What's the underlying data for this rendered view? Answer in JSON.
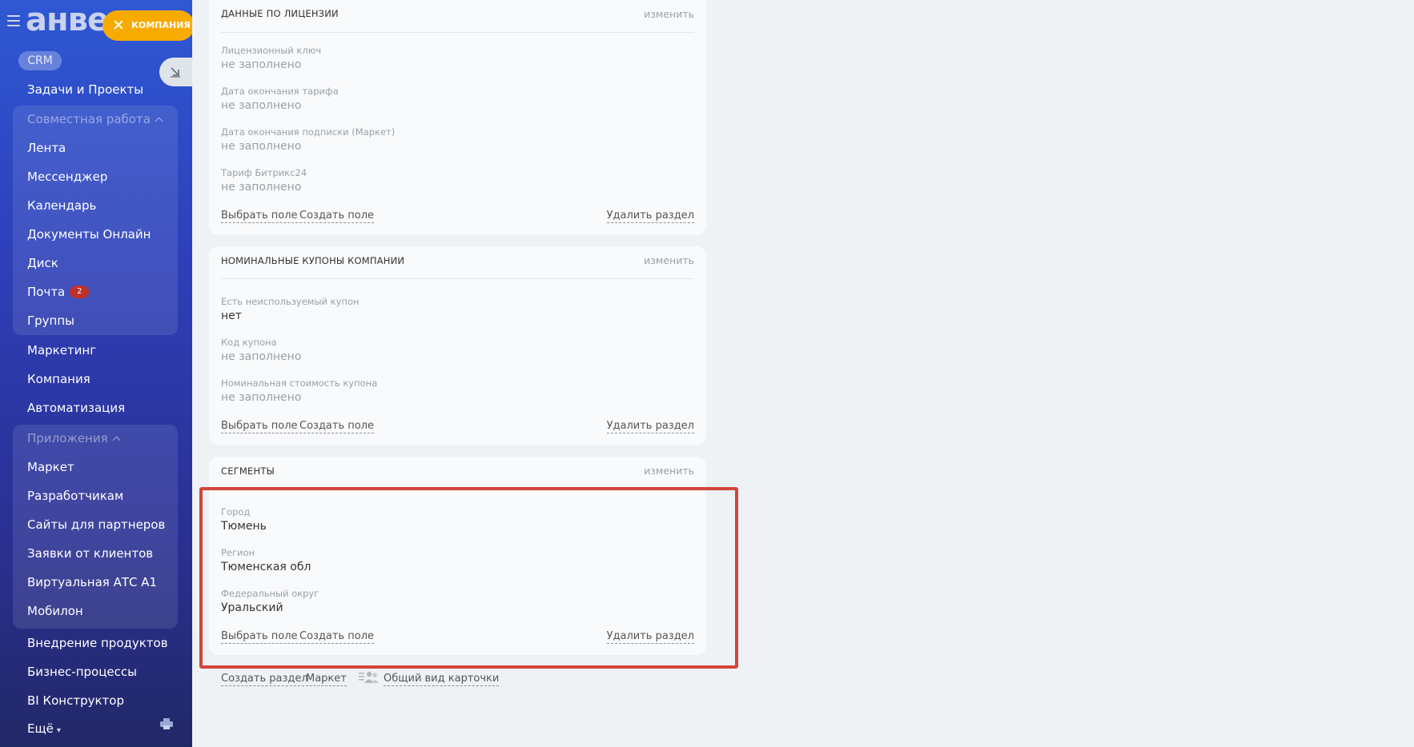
{
  "sidebar": {
    "logo": "анвер",
    "company_badge": "КОМПАНИЯ",
    "crm": "CRM",
    "tasks": "Задачи и Проекты",
    "collab_group": {
      "title": "Совместная работа",
      "items": [
        "Лента",
        "Мессенджер",
        "Календарь",
        "Документы Онлайн",
        "Диск",
        "Почта",
        "Группы"
      ]
    },
    "mail_badge": "2",
    "marketing": "Маркетинг",
    "company": "Компания",
    "automation": "Автоматизация",
    "apps_group": {
      "title": "Приложения",
      "items": [
        "Маркет",
        "Разработчикам",
        "Сайты для партнеров",
        "Заявки от клиентов",
        "Виртуальная АТС А1",
        "Мобилон"
      ]
    },
    "after_items": [
      "Внедрение продуктов",
      "Бизнес-процессы",
      "BI Конструктор"
    ],
    "more": "Ещё",
    "colors": {
      "accent_badge": "#f7ab00",
      "mail_badge": "#c0302c"
    }
  },
  "sections": [
    {
      "title": "ДАННЫЕ ПО ЛИЦЕНЗИИ",
      "edit": "изменить",
      "fields": [
        {
          "label": "Лицензионный ключ",
          "value": "не заполнено"
        },
        {
          "label": "Дата окончания тарифа",
          "value": "не заполнено"
        },
        {
          "label": "Дата окончания подписки (Маркет)",
          "value": "не заполнено"
        },
        {
          "label": "Тариф Битрикс24",
          "value": "не заполнено"
        }
      ],
      "links": {
        "select": "Выбрать поле",
        "create": "Создать поле",
        "delete": "Удалить раздел"
      }
    },
    {
      "title": "НОМИНАЛЬНЫЕ КУПОНЫ КОМПАНИИ",
      "edit": "изменить",
      "fields": [
        {
          "label": "Есть неиспользуемый купон",
          "value": "нет"
        },
        {
          "label": "Код купона",
          "value": "не заполнено"
        },
        {
          "label": "Номинальная стоимость купона",
          "value": "не заполнено"
        }
      ],
      "links": {
        "select": "Выбрать поле",
        "create": "Создать поле",
        "delete": "Удалить раздел"
      }
    },
    {
      "title": "СЕГМЕНТЫ",
      "edit": "изменить",
      "fields": [
        {
          "label": "Город",
          "value": "Тюмень"
        },
        {
          "label": "Регион",
          "value": "Тюменская обл"
        },
        {
          "label": "Федеральный округ",
          "value": "Уральский"
        }
      ],
      "links": {
        "select": "Выбрать поле",
        "create": "Создать поле",
        "delete": "Удалить раздел"
      }
    }
  ],
  "bottom_links": {
    "create_section": "Создать раздел",
    "market": "Маркет",
    "common_view": "Общий вид карточки"
  },
  "highlight_color": "#d2453a"
}
